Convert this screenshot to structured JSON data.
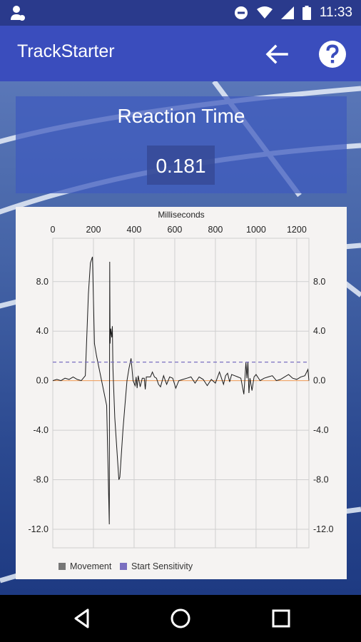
{
  "status_bar": {
    "time": "11:33",
    "icons": [
      "profile-icon",
      "do-not-disturb-icon",
      "wifi-icon",
      "signal-icon",
      "battery-icon"
    ]
  },
  "app_bar": {
    "title": "TrackStarter",
    "icons": [
      "back-arrow-icon",
      "help-icon"
    ]
  },
  "reaction": {
    "title": "Reaction Time",
    "value": "0.181"
  },
  "colors": {
    "app_bar": "#3a4dbd",
    "status_bar": "#2a3a8c",
    "movement": "#1a1a1a",
    "start_sensitivity": "#7a6fc0",
    "zero_line": "#f5a05a"
  },
  "nav_bar": {
    "icons": [
      "back-triangle-icon",
      "home-circle-icon",
      "recents-square-icon"
    ]
  },
  "chart_data": {
    "type": "line",
    "title": "",
    "xlabel": "Milliseconds",
    "ylabel": "",
    "xlim": [
      0,
      1260
    ],
    "ylim": [
      -13.5,
      11.5
    ],
    "x_ticks": [
      0,
      200,
      400,
      600,
      800,
      1000,
      1200
    ],
    "y_ticks": [
      8.0,
      4.0,
      0.0,
      -4.0,
      -8.0,
      -12.0
    ],
    "y_tick_labels": [
      "8.0",
      "4.0",
      "0.0",
      "-4.0",
      "-8.0",
      "-12.0"
    ],
    "grid": true,
    "legend_position": "bottom-left",
    "series": [
      {
        "name": "Movement",
        "color": "#1a1a1a",
        "x": [
          0,
          20,
          40,
          60,
          80,
          100,
          120,
          140,
          160,
          175,
          185,
          195,
          205,
          215,
          240,
          265,
          278,
          280,
          282,
          285,
          290,
          293,
          296,
          305,
          325,
          330,
          345,
          355,
          365,
          375,
          385,
          395,
          405,
          410,
          415,
          420,
          430,
          440,
          450,
          455,
          460,
          470,
          480,
          490,
          500,
          510,
          520,
          530,
          545,
          560,
          575,
          590,
          605,
          620,
          640,
          660,
          680,
          700,
          720,
          740,
          760,
          780,
          800,
          820,
          840,
          850,
          860,
          870,
          880,
          895,
          910,
          925,
          940,
          945,
          950,
          955,
          960,
          965,
          970,
          980,
          990,
          1000,
          1020,
          1040,
          1060,
          1080,
          1100,
          1120,
          1140,
          1160,
          1180,
          1200,
          1220,
          1240,
          1255,
          1260
        ],
        "y": [
          0.0,
          0.1,
          0.0,
          0.2,
          0.1,
          0.3,
          0.1,
          0.0,
          0.4,
          7.0,
          9.5,
          10.0,
          3.0,
          2.0,
          0.0,
          -2.0,
          -11.6,
          9.6,
          3.0,
          4.2,
          3.5,
          4.4,
          1.0,
          -3.0,
          -8.0,
          -7.8,
          -4.0,
          -2.0,
          0.0,
          1.0,
          1.8,
          0.0,
          -0.4,
          0.3,
          -0.6,
          0.4,
          -0.5,
          0.2,
          0.2,
          -0.7,
          0.3,
          0.3,
          0.3,
          0.7,
          0.3,
          0.2,
          -0.3,
          -0.5,
          0.4,
          -0.3,
          0.3,
          0.2,
          -0.6,
          0.0,
          0.1,
          0.2,
          0.3,
          -0.2,
          0.3,
          0.1,
          -0.4,
          0.1,
          -0.2,
          0.7,
          -0.3,
          0.4,
          0.6,
          -0.1,
          0.5,
          0.4,
          0.3,
          0.2,
          -1.1,
          0.2,
          1.5,
          0.2,
          1.5,
          -1.0,
          0.2,
          -0.8,
          0.3,
          0.5,
          0.0,
          0.2,
          0.3,
          0.4,
          0.0,
          0.1,
          0.3,
          0.5,
          0.2,
          0.1,
          0.3,
          0.4,
          0.9,
          0.0
        ]
      },
      {
        "name": "Start Sensitivity",
        "color": "#7a6fc0",
        "style": "dashed",
        "x": [
          0,
          1260
        ],
        "y": [
          1.5,
          1.5
        ]
      }
    ]
  }
}
